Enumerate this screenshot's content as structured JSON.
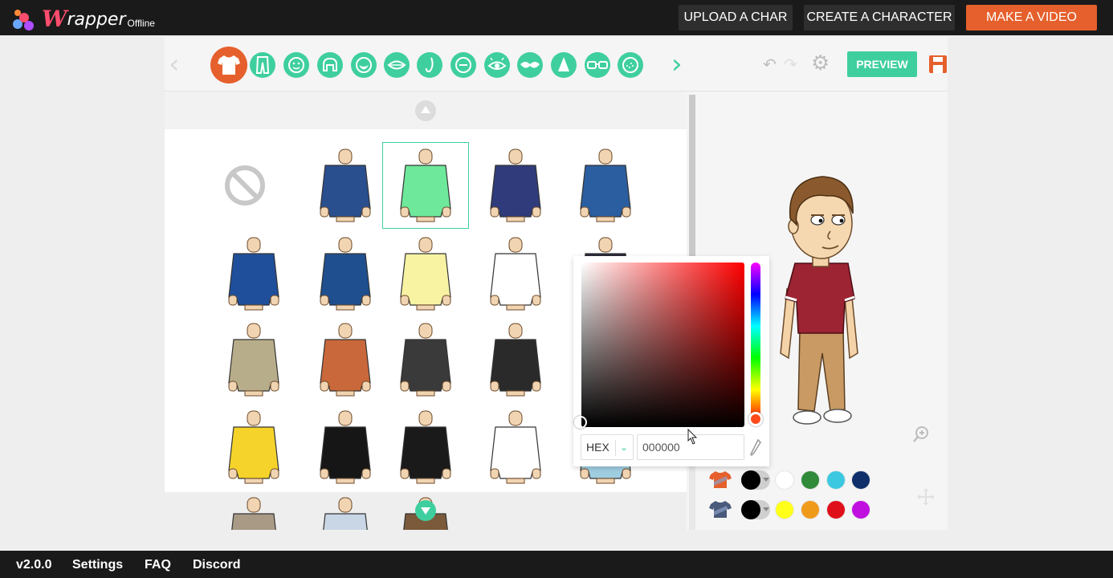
{
  "app": {
    "logo_w": "W",
    "logo_text": "rapper",
    "logo_sub": "Offline"
  },
  "header": {
    "upload_label": "UPLOAD A CHAR",
    "create_label": "CREATE A CHARACTER",
    "make_video_label": "MAKE A VIDEO"
  },
  "colors": {
    "accent": "#3fcf9f",
    "primary": "#e5602c",
    "topbar": "#1a1a1a"
  },
  "toolbar": {
    "categories": [
      "shirt-icon",
      "pants-icon",
      "face-icon",
      "hair-icon",
      "beard-icon",
      "mouth-icon",
      "nose-icon",
      "eyebrow-icon",
      "eye-icon",
      "mask-icon",
      "hat-icon",
      "glasses-icon",
      "face-detail-icon"
    ],
    "active_category": "shirt-icon",
    "preview_label": "PREVIEW"
  },
  "grid": {
    "items": [
      {
        "name": "none",
        "color": ""
      },
      {
        "name": "polo-blue",
        "color": "#2a4f8f"
      },
      {
        "name": "tshirt-green",
        "color": "#6ee89a"
      },
      {
        "name": "suit-navy",
        "color": "#2f3b7a"
      },
      {
        "name": "hoodie-blue",
        "color": "#2b5ea0"
      },
      {
        "name": "police-shirt",
        "color": "#1f4f9a"
      },
      {
        "name": "puffer-jacket",
        "color": "#1f4f8f"
      },
      {
        "name": "dress-shirt-yellow",
        "color": "#f7f3a3"
      },
      {
        "name": "tuxedo-white",
        "color": "#ffffff"
      },
      {
        "name": "dark-suit-partial",
        "color": "#2a2a3a"
      },
      {
        "name": "camo-jacket",
        "color": "#b8ad8a"
      },
      {
        "name": "overalls-orange",
        "color": "#c9683a"
      },
      {
        "name": "blazer-dark",
        "color": "#3a3a3a"
      },
      {
        "name": "zombie-suit",
        "color": "#2a2a2a"
      },
      {
        "name": "jersey-orange",
        "color": "#f59a3a"
      },
      {
        "name": "jersey-yellow",
        "color": "#f5d32a"
      },
      {
        "name": "skull-tee",
        "color": "#161616"
      },
      {
        "name": "leather-jacket",
        "color": "#1a1a1a"
      },
      {
        "name": "chain-tee",
        "color": "#ffffff"
      },
      {
        "name": "tee-lightblue",
        "color": "#9fcde0"
      },
      {
        "name": "vest-gray",
        "color": "#a89a85"
      },
      {
        "name": "vest-blue",
        "color": "#c9d6e6"
      },
      {
        "name": "jacket-brown",
        "color": "#7a5a3a"
      }
    ],
    "selected_index": 2
  },
  "character": {
    "shirt_color": "#9c2433",
    "pants_color": "#c99a63",
    "hair_color": "#8a5a2e"
  },
  "color_picker": {
    "mode": "HEX",
    "value": "000000"
  },
  "swatches": {
    "rows": [
      {
        "icon": "shirt-icon",
        "current": "#000000",
        "colors": [
          "#ffffff",
          "#2f8a3a",
          "#3cc8e0",
          "#0f2f6a"
        ]
      },
      {
        "icon": "shirt-icon",
        "current": "#000000",
        "colors": [
          "#ffff1a",
          "#f09a1a",
          "#e0101a",
          "#c010e0"
        ]
      }
    ]
  },
  "footer": {
    "version": "v2.0.0",
    "settings": "Settings",
    "faq": "FAQ",
    "discord": "Discord"
  }
}
